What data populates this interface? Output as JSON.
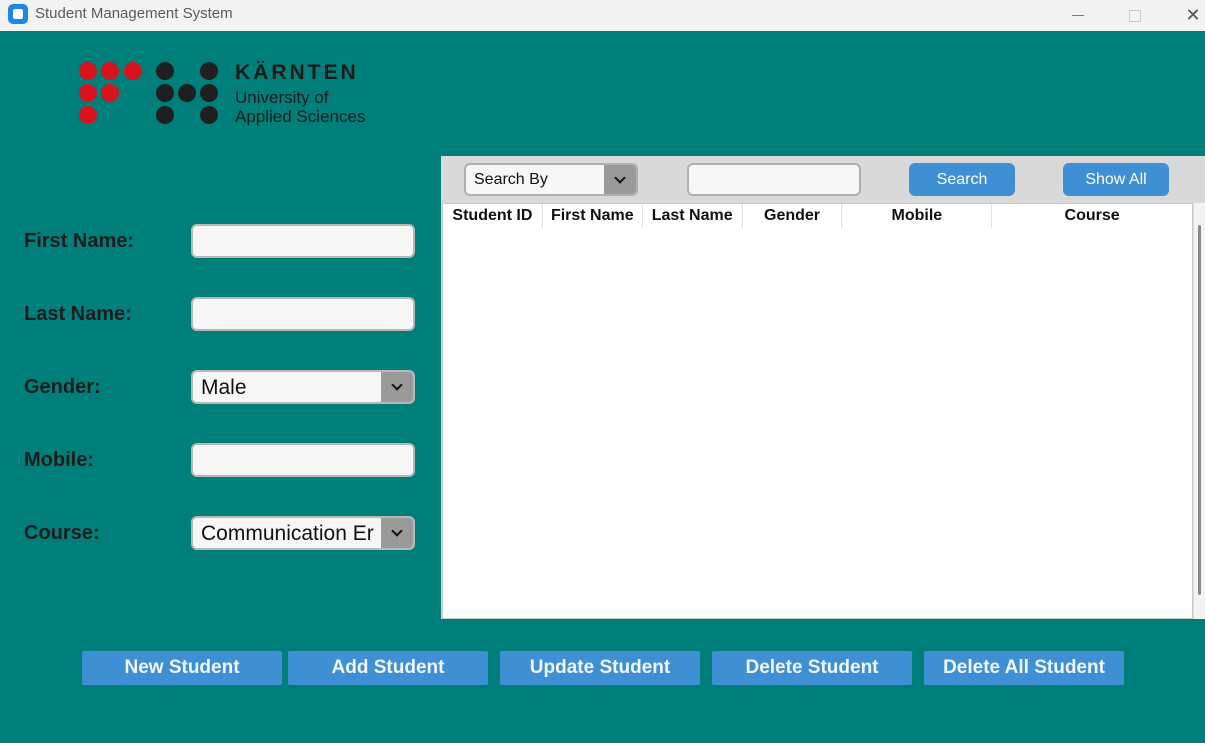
{
  "window": {
    "title": "Student Management System",
    "minimize_icon": "minimize-icon",
    "maximize_icon": "maximize-icon",
    "close_glyph": "✕"
  },
  "logo": {
    "title": "KÄRNTEN",
    "line1": "University of",
    "line2": "Applied Sciences",
    "colors": {
      "red": "#d7131e",
      "black": "#1f1f1f"
    }
  },
  "form": {
    "first_name_label": "First Name:",
    "first_name_value": "",
    "last_name_label": "Last Name:",
    "last_name_value": "",
    "gender_label": "Gender:",
    "gender_value": "Male",
    "mobile_label": "Mobile:",
    "mobile_value": "",
    "course_label": "Course:",
    "course_value": "Communication Er"
  },
  "search": {
    "search_by_value": "Search By",
    "search_text": "",
    "search_button": "Search",
    "show_all_button": "Show All"
  },
  "table": {
    "columns": [
      "Student ID",
      "First Name",
      "Last Name",
      "Gender",
      "Mobile",
      "Course"
    ],
    "rows": []
  },
  "actions": {
    "new_student": "New Student",
    "add_student": "Add Student",
    "update_student": "Update Student",
    "delete_student": "Delete Student",
    "delete_all_student": "Delete All Student"
  },
  "colors": {
    "background": "#007f7a",
    "button": "#3f8fd5",
    "panel": "#d9d9d9"
  }
}
